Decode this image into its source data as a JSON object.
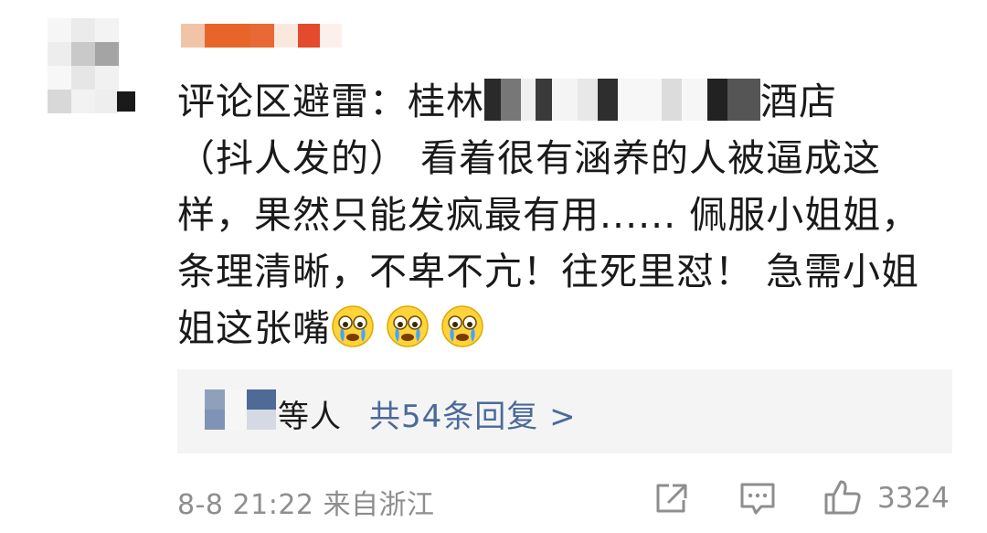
{
  "comment": {
    "prefix": "评论区避雷：桂林",
    "hotel_suffix": "酒店",
    "body": "（抖人发的） 看着很有涵养的人被逼成这样，果然只能发疯最有用...... 佩服小姐姐，条理清晰，不卑不亢！往死里怼！ 急需小姐姐这张嘴",
    "emojis": [
      "crying-face",
      "crying-face",
      "crying-face"
    ]
  },
  "replies": {
    "prefix": "等人",
    "link": "共54条回复 >"
  },
  "footer": {
    "timestamp": "8-8 21:22",
    "location": "来自浙江",
    "like_count": "3324"
  },
  "colors": {
    "text": "#1a1a1a",
    "link": "#4b6a99",
    "meta": "#8e8e8e",
    "reply_bg": "#f4f4f4",
    "username_orange": "#e8652a",
    "username_red": "#e44a2d"
  },
  "icons": [
    "share-icon",
    "comment-icon",
    "thumbs-up-icon"
  ]
}
